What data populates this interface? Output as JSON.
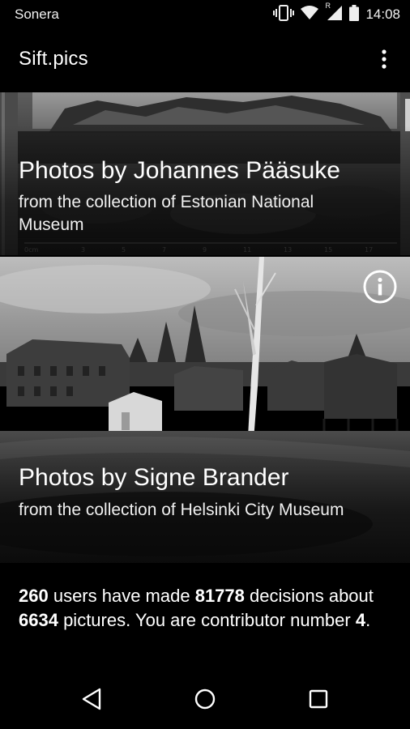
{
  "status_bar": {
    "carrier": "Sonera",
    "time": "14:08",
    "roaming_indicator": "R",
    "icons": [
      "vibrate-icon",
      "wifi-icon",
      "signal-icon",
      "battery-icon"
    ]
  },
  "app_bar": {
    "title": "Sift.pics",
    "menu_icon": "more-vert-icon"
  },
  "collections": [
    {
      "title": "Photos by Johannes Pääsuke",
      "subtitle": "from the collection of Estonian National Museum"
    },
    {
      "title": "Photos by Signe Brander",
      "subtitle": "from the collection of Helsinki City Museum",
      "info_icon": "info-icon"
    }
  ],
  "stats": {
    "users": "260",
    "text_1": " users have made ",
    "decisions": "81778",
    "text_2": " decisions about ",
    "pictures": "6634",
    "text_3": " pictures. You are contributor number ",
    "contributor_number": "4",
    "text_4": "."
  },
  "nav_bar": {
    "icons": [
      "back-icon",
      "home-icon",
      "recents-icon"
    ]
  },
  "colors": {
    "background": "#000000",
    "text": "#ffffff"
  }
}
